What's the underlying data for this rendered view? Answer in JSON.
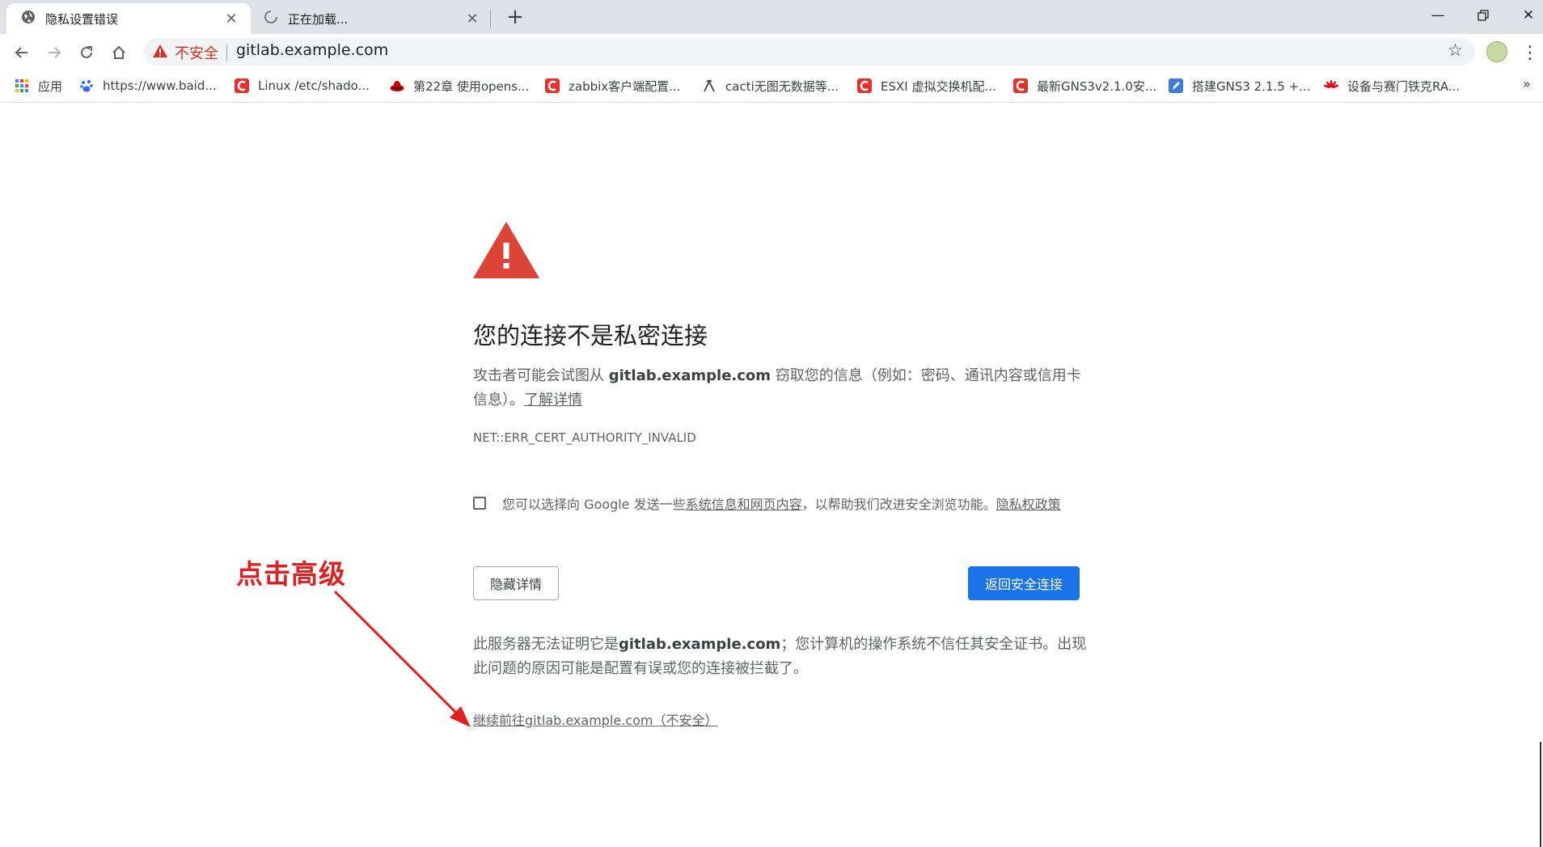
{
  "tabs": [
    {
      "title": "隐私设置错误",
      "icon": "globe-icon"
    },
    {
      "title": "正在加载...",
      "icon": "loading-spinner-icon"
    }
  ],
  "address": {
    "security_label": "不安全",
    "url": "gitlab.example.com"
  },
  "bookmarks": [
    {
      "label": "应用",
      "icon": "apps-grid-icon"
    },
    {
      "label": "https://www.baid...",
      "icon": "baidu-paw-icon"
    },
    {
      "label": "Linux /etc/shado...",
      "icon": "c-logo-icon"
    },
    {
      "label": "第22章 使用opens...",
      "icon": "redhat-icon"
    },
    {
      "label": "zabbix客户端配置...",
      "icon": "c-logo-icon"
    },
    {
      "label": "cacti无图无数据等...",
      "icon": "tool-icon"
    },
    {
      "label": "ESXI 虚拟交换机配...",
      "icon": "c-logo-icon"
    },
    {
      "label": "最新GNS3v2.1.0安...",
      "icon": "c-logo-icon"
    },
    {
      "label": "搭建GNS3 2.1.5 +...",
      "icon": "pen-icon"
    },
    {
      "label": "设备与赛门铁克RA...",
      "icon": "huawei-icon"
    }
  ],
  "page": {
    "title": "您的连接不是私密连接",
    "desc_before": "攻击者可能会试图从 ",
    "desc_host": "gitlab.example.com",
    "desc_after": " 窃取您的信息（例如：密码、通讯内容或信用卡信息）。",
    "learn_more": "了解详情",
    "error_code": "NET::ERR_CERT_AUTHORITY_INVALID",
    "optin_before": "您可以选择向 Google 发送一些",
    "optin_link": "系统信息和网页内容",
    "optin_after": "，以帮助我们改进安全浏览功能。",
    "privacy_policy": "隐私权政策",
    "hide_details": "隐藏详情",
    "back_to_safety": "返回安全连接",
    "detail_before": "此服务器无法证明它是",
    "detail_host": "gitlab.example.com",
    "detail_after": "；您计算机的操作系统不信任其安全证书。出现此问题的原因可能是配置有误或您的连接被拦截了。",
    "proceed_link": "继续前往gitlab.example.com（不安全）"
  },
  "annotation": {
    "text": "点击高级"
  },
  "colors": {
    "warning_red": "#db4437",
    "primary_blue": "#1a73e8",
    "annotation_red": "#e02020"
  }
}
